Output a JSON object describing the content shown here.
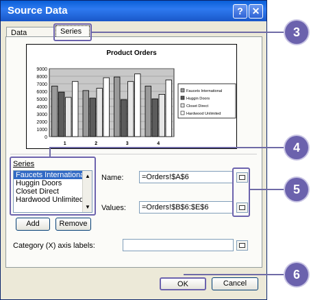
{
  "window": {
    "title": "Source Data",
    "help_glyph": "?",
    "close_glyph": "✕"
  },
  "tabs": [
    {
      "label": "Data Range",
      "active": false
    },
    {
      "label": "Series",
      "active": true
    }
  ],
  "chart_data": {
    "type": "bar",
    "title": "Product Orders",
    "categories": [
      "1",
      "2",
      "3",
      "4"
    ],
    "series": [
      {
        "name": "Faucets International",
        "values": [
          6700,
          6100,
          7900,
          6700
        ]
      },
      {
        "name": "Huggin Doors",
        "values": [
          5900,
          5100,
          4900,
          5000
        ]
      },
      {
        "name": "Closet Direct",
        "values": [
          5200,
          6400,
          7300,
          5600
        ]
      },
      {
        "name": "Hardwood Unlimited",
        "values": [
          7300,
          7800,
          8300,
          7500
        ]
      }
    ],
    "y_ticks": [
      "0",
      "1000",
      "2000",
      "3000",
      "4000",
      "5000",
      "6000",
      "7000",
      "8000",
      "9000"
    ],
    "ylim": [
      0,
      9000
    ],
    "legend_labels": [
      "Faucets International",
      "Huggin Doors",
      "Closet Direct",
      "Hardwood Unlimited"
    ],
    "series_colors": [
      "#9a9a9a",
      "#5c5c5c",
      "#e6e6e6",
      "#ffffff"
    ],
    "legend": "right",
    "grid": true
  },
  "series_panel": {
    "label": "Series",
    "items": [
      "Faucets International",
      "Huggin Doors",
      "Closet Direct",
      "Hardwood Unlimited"
    ],
    "selected_index": 0,
    "add_label": "Add",
    "remove_label": "Remove"
  },
  "name_field": {
    "label": "Name:",
    "value": "=Orders!$A$6"
  },
  "values_field": {
    "label": "Values:",
    "value": "=Orders!$B$6:$E$6"
  },
  "category_field": {
    "label": "Category (X) axis labels:",
    "value": ""
  },
  "buttons": {
    "ok": "OK",
    "cancel": "Cancel"
  },
  "callouts": [
    "3",
    "4",
    "5",
    "6"
  ],
  "colors": {
    "titlebar": "#0a5fd8",
    "callout": "#6b62ad",
    "selection": "#316ac5"
  }
}
